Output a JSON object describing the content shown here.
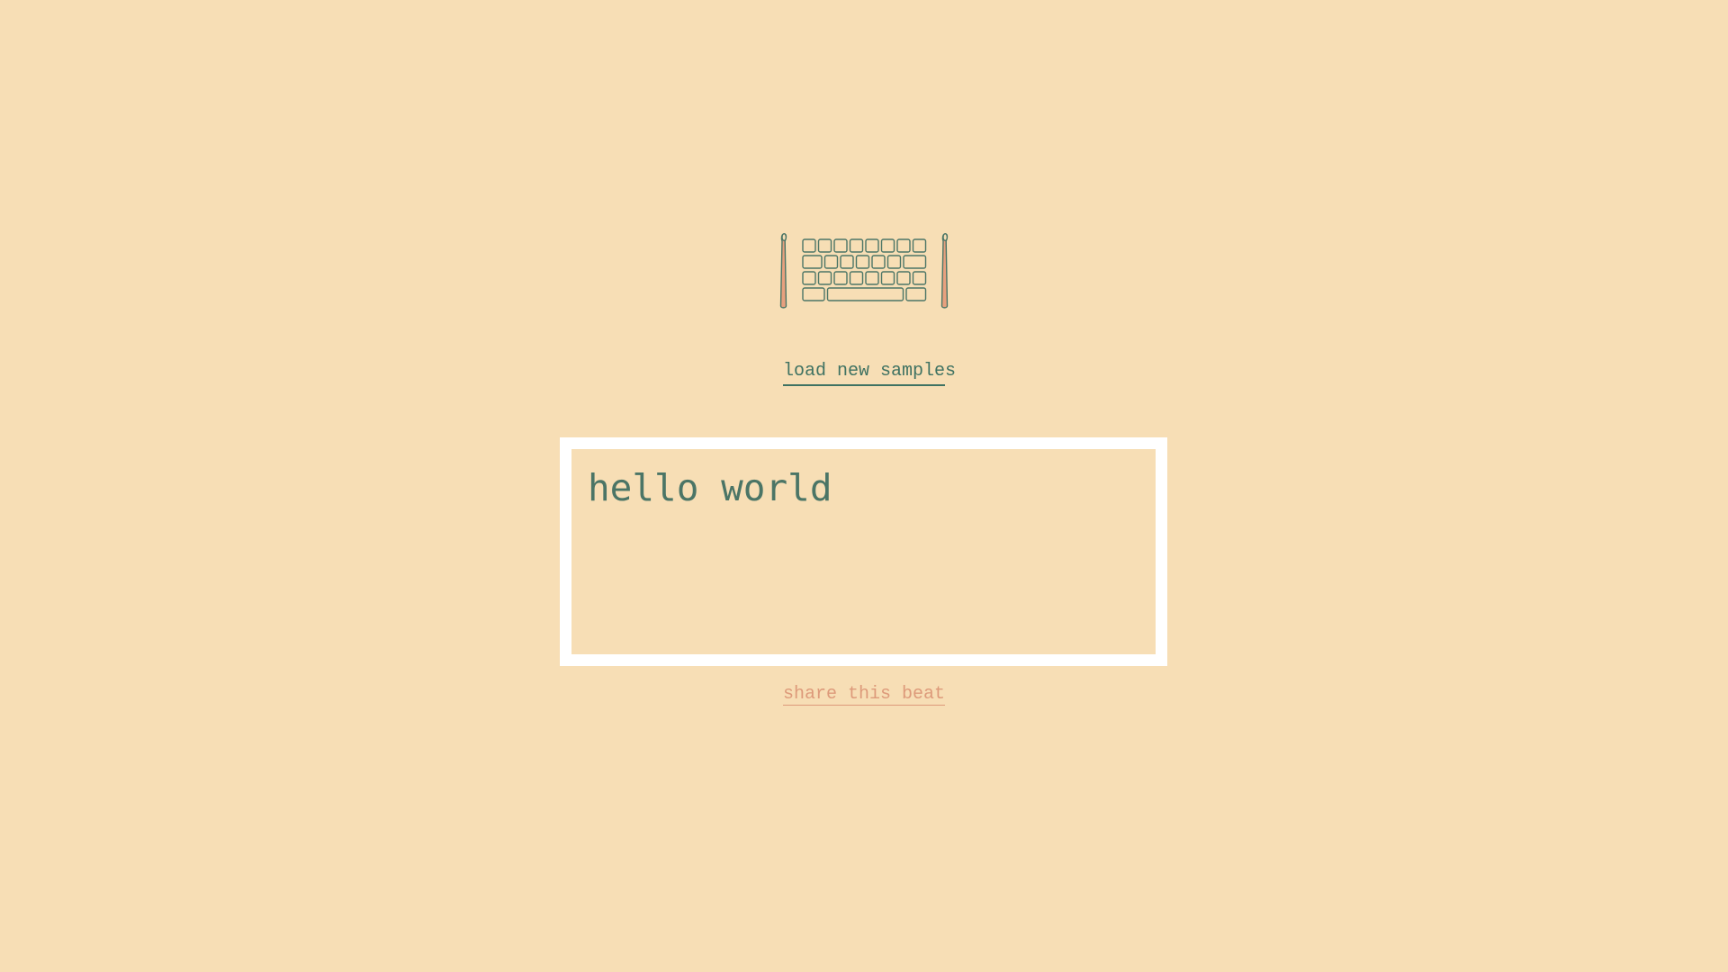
{
  "colors": {
    "background": "#f7deb5",
    "primary_text": "#3f7262",
    "accent": "#dd9a7a",
    "editor_border": "#ffffff"
  },
  "logo": {
    "icon": "keyboard-drumsticks-icon"
  },
  "load_samples": {
    "label": "load new samples"
  },
  "editor": {
    "value": "hello world"
  },
  "share": {
    "label": "share this beat"
  }
}
